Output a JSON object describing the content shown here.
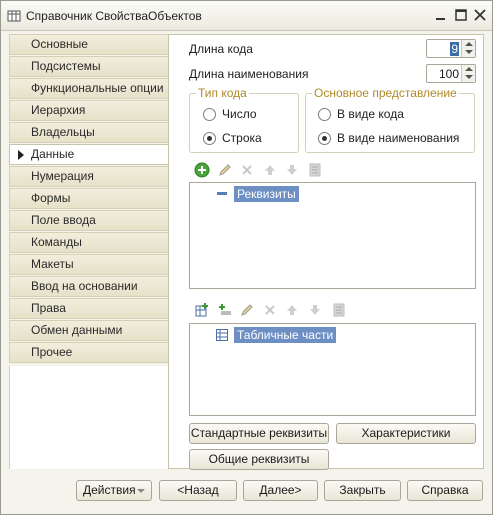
{
  "window": {
    "title": "Справочник СвойстваОбъектов",
    "icon": "catalog-icon",
    "controls": [
      "minimize-icon",
      "maximize-icon",
      "close-icon"
    ]
  },
  "nav": {
    "items": [
      {
        "label": "Основные"
      },
      {
        "label": "Подсистемы"
      },
      {
        "label": "Функциональные опции"
      },
      {
        "label": "Иерархия"
      },
      {
        "label": "Владельцы"
      },
      {
        "label": "Данные",
        "active": true
      },
      {
        "label": "Нумерация"
      },
      {
        "label": "Формы"
      },
      {
        "label": "Поле ввода"
      },
      {
        "label": "Команды"
      },
      {
        "label": "Макеты"
      },
      {
        "label": "Ввод на основании"
      },
      {
        "label": "Права"
      },
      {
        "label": "Обмен данными"
      },
      {
        "label": "Прочее"
      }
    ]
  },
  "data_tab": {
    "code_length": {
      "label": "Длина кода",
      "value": "9"
    },
    "name_length": {
      "label": "Длина наименования",
      "value": "100"
    },
    "code_type": {
      "title": "Тип кода",
      "options": [
        {
          "label": "Число",
          "selected": false
        },
        {
          "label": "Строка",
          "selected": true
        }
      ]
    },
    "main_presentation": {
      "title": "Основное представление",
      "options": [
        {
          "label": "В виде кода",
          "selected": false
        },
        {
          "label": "В виде наименования",
          "selected": true
        }
      ]
    },
    "attributes_toolbar": [
      "add-icon",
      "edit-icon",
      "delete-icon",
      "move-up-icon",
      "move-down-icon",
      "sort-icon"
    ],
    "attributes_tree": {
      "root": "Реквизиты"
    },
    "tabular_toolbar": [
      "add-table-icon",
      "add-column-icon",
      "edit-icon",
      "delete-icon",
      "move-up-icon",
      "move-down-icon",
      "sort-icon"
    ],
    "tabular_tree": {
      "root": "Табличные части"
    },
    "buttons": {
      "standard": "Стандартные реквизиты",
      "characteristics": "Характеристики",
      "common": "Общие реквизиты"
    }
  },
  "footer": {
    "actions": "Действия",
    "back": "<Назад",
    "next": "Далее>",
    "close": "Закрыть",
    "help": "Справка"
  }
}
